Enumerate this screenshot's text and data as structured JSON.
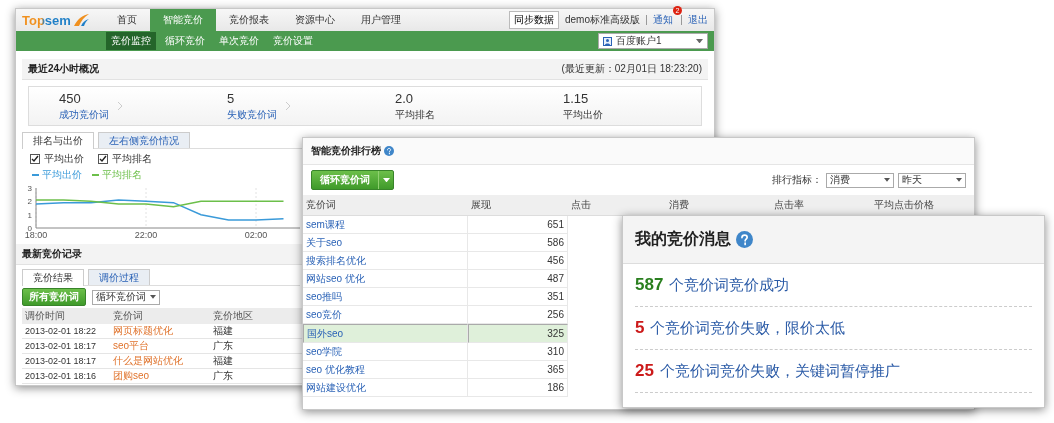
{
  "main_window": {
    "logo": "Topsem",
    "nav": [
      {
        "label": "首页",
        "selected": false
      },
      {
        "label": "智能竞价",
        "selected": true
      },
      {
        "label": "竞价报表",
        "selected": false
      },
      {
        "label": "资源中心",
        "selected": false
      },
      {
        "label": "用户管理",
        "selected": false
      }
    ],
    "sync_button": "同步数据",
    "user": "demo标准高级版",
    "notice": {
      "label": "通知",
      "badge": "2"
    },
    "logout": "退出",
    "subnav": [
      {
        "label": "竞价监控",
        "selected": true
      },
      {
        "label": "循环竞价",
        "selected": false
      },
      {
        "label": "单次竞价",
        "selected": false
      },
      {
        "label": "竞价设置",
        "selected": false
      }
    ],
    "account_select": "百度账户1",
    "overview": {
      "title": "最近24小时概况",
      "updated": "(最近更新：02月01日 18:23:20)",
      "stats": [
        {
          "value": "450",
          "label": "成功竞价词",
          "kind": "link"
        },
        {
          "value": "5",
          "label": "失败竞价词",
          "kind": "link"
        },
        {
          "value": "2.0",
          "label": "平均排名",
          "kind": "plain"
        },
        {
          "value": "1.15",
          "label": "平均出价",
          "kind": "plain"
        }
      ]
    },
    "chart_panel": {
      "tabs": [
        {
          "label": "排名与出价",
          "selected": true
        },
        {
          "label": "左右侧竞价情况",
          "selected": false
        }
      ],
      "checkboxes": [
        {
          "label": "平均出价",
          "checked": true
        },
        {
          "label": "平均排名",
          "checked": true
        }
      ],
      "chart_data": {
        "type": "line",
        "categories": [
          "18:00",
          null,
          null,
          null,
          "22:00",
          null,
          null,
          null,
          "02:00",
          null
        ],
        "ylim": [
          0,
          3
        ],
        "yticks": [
          0,
          1,
          2,
          3
        ],
        "series": [
          {
            "name": "平均出价",
            "color": "#3a9ad9",
            "values": [
              1.8,
              1.9,
              1.9,
              2.1,
              2.0,
              1.9,
              1.0,
              0.6,
              0.6,
              0.7
            ]
          },
          {
            "name": "平均排名",
            "color": "#6cbf4a",
            "values": [
              2.1,
              2.1,
              2.0,
              1.8,
              1.8,
              1.6,
              2.0,
              2.0,
              2.0,
              2.0
            ]
          }
        ]
      }
    },
    "records": {
      "title": "最新竞价记录",
      "tabs": [
        {
          "label": "竞价结果",
          "selected": true
        },
        {
          "label": "调价过程",
          "selected": false
        }
      ],
      "filter_button": "所有竞价词",
      "filter_select": "循环竞价词",
      "columns": [
        "调价时间",
        "竞价词",
        "竞价地区"
      ],
      "rows": [
        {
          "time": "2013-02-01 18:22",
          "keyword": "网页标题优化",
          "region": "福建"
        },
        {
          "time": "2013-02-01 18:17",
          "keyword": "seo平台",
          "region": "广东"
        },
        {
          "time": "2013-02-01 18:17",
          "keyword": "什么是网站优化",
          "region": "福建"
        },
        {
          "time": "2013-02-01 18:16",
          "keyword": "团购seo",
          "region": "广东"
        }
      ]
    }
  },
  "ranking_window": {
    "title": "智能竞价排行榜",
    "action_button": "循环竞价词",
    "metric_label": "排行指标：",
    "metric_select": "消费",
    "period_select": "昨天",
    "columns": [
      "竞价词",
      "展现",
      "点击",
      "消费",
      "点击率",
      "平均点击价格"
    ],
    "rows": [
      {
        "keyword": "sem课程",
        "impressions": "651",
        "selected": false
      },
      {
        "keyword": "关于seo",
        "impressions": "586",
        "selected": false
      },
      {
        "keyword": "搜索排名优化",
        "impressions": "456",
        "selected": false
      },
      {
        "keyword": "网站seo 优化",
        "impressions": "487",
        "selected": false
      },
      {
        "keyword": "seo推吗",
        "impressions": "351",
        "selected": false
      },
      {
        "keyword": "seo竞价",
        "impressions": "256",
        "selected": false
      },
      {
        "keyword": "国外seo",
        "impressions": "325",
        "selected": true
      },
      {
        "keyword": "seo学院",
        "impressions": "310",
        "selected": false
      },
      {
        "keyword": "seo 优化教程",
        "impressions": "365",
        "selected": false
      },
      {
        "keyword": "网站建设优化",
        "impressions": "186",
        "selected": false
      }
    ]
  },
  "messages_window": {
    "title": "我的竞价消息",
    "items": [
      {
        "count": "587",
        "text": "个竞价词竞价成功",
        "color": "#2a7f1f"
      },
      {
        "count": "5",
        "text": "个竞价词竞价失败，限价太低",
        "color": "#cc1a1a"
      },
      {
        "count": "25",
        "text": "个竞价词竞价失败，关键词暂停推广",
        "color": "#cc1a1a"
      }
    ]
  }
}
